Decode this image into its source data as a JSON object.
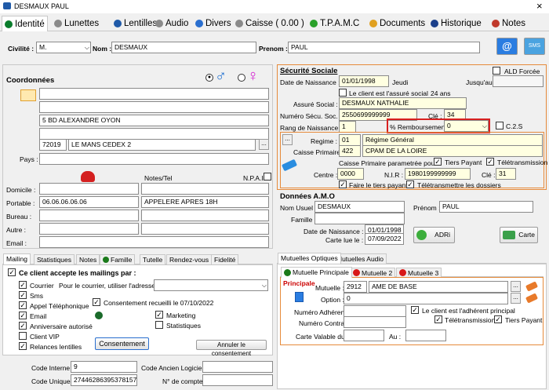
{
  "window": {
    "title": "DESMAUX PAUL",
    "close": "×"
  },
  "tabs": [
    {
      "label": "Identité",
      "icon": "#0a7d2c"
    },
    {
      "label": "Lunettes",
      "icon": "#8a8a8a"
    },
    {
      "label": "Lentilles",
      "icon": "#1f5aa8"
    },
    {
      "label": "Audio",
      "icon": "#8a8a8a"
    },
    {
      "label": "Divers",
      "icon": "#2a6fcf"
    },
    {
      "label": "Caisse ( 0.00 )",
      "icon": "#8a8a8a"
    },
    {
      "label": "T.P.A.M.C",
      "icon": "#2aa02a"
    },
    {
      "label": "Documents",
      "icon": "#e0a020"
    },
    {
      "label": "Historique",
      "icon": "#1a3f8a"
    },
    {
      "label": "Notes",
      "icon": "#c0392b"
    }
  ],
  "header": {
    "civilite_label": "Civilité :",
    "civilite_value": "M.",
    "nom_label": "Nom :",
    "nom_value": "DESMAUX",
    "prenom_label": "Prenom :",
    "prenom_value": "PAUL",
    "at": "@",
    "sms": "SMS"
  },
  "coordonnees": {
    "title": "Coordonnées",
    "addr1": "",
    "addr2": "",
    "addr3": "5 BD ALEXANDRE OYON",
    "addr4": "",
    "cp": "72019",
    "ville": "LE MANS CEDEX 2",
    "dots": "...",
    "pays_label": "Pays :",
    "pays_value": "",
    "notes_label": "Notes/Tel",
    "npai_label": "N.P.A.I",
    "phones": [
      {
        "label": "Domicile :",
        "value": "",
        "note": ""
      },
      {
        "label": "Portable :",
        "value": "06.06.06.06.06",
        "note": "APPELERE APRES 18H"
      },
      {
        "label": "Bureau :",
        "value": "",
        "note": ""
      },
      {
        "label": "Autre :",
        "value": "",
        "note": ""
      },
      {
        "label": "Email :",
        "value": "",
        "note": ""
      }
    ]
  },
  "secu": {
    "title": "Sécurité Sociale",
    "ald_label": "ALD Forcée",
    "dn_label": "Date de Naissance :",
    "dn_value": "01/01/1998",
    "jour": "Jeudi",
    "jusqu_label": "Jusqu'au :",
    "jusqu_value": "",
    "assure_chk_label": "Le client est l'assuré social",
    "age": "24 ans",
    "assure_label": "Assuré Social :",
    "assure_value": "DESMAUX NATHALIE",
    "nss_label": "Numéro Sécu. Soc. :",
    "nss_value": "2550699999999",
    "cle_label": "Clé :",
    "cle_value": "34",
    "rang_label": "Rang de Naissance :",
    "rang_value": "1",
    "remb_label": "% Remboursement :",
    "remb_value": "0",
    "c2s_label": "C.2.S",
    "regime_label": "Regime :",
    "regime_code": "01",
    "regime_value": "Régime Général",
    "caisse_label": "Caisse Primaire :",
    "caisse_code": "422",
    "caisse_value": "CPAM DE LA LOIRE",
    "param_label": "Caisse Primaire parametrée pour :",
    "tiers_label": "Tiers Payant",
    "teletrans_label": "Télétransmission",
    "centre_label": "Centre :",
    "centre_value": "0000",
    "nir_label": "N.I.R :",
    "nir_value": "1980199999999",
    "cle2_label": "Clé :",
    "cle2_value": "31",
    "faire_label": "Faire le tiers payant",
    "teledos_label": "Télétransmettre les dossiers",
    "dots": "..."
  },
  "amo": {
    "title": "Données A.M.O",
    "nom_label": "Nom Usuel :",
    "nom_value": "DESMAUX",
    "prenom_label": "Prénom :",
    "prenom_value": "PAUL",
    "famille_label": "Famille :",
    "famille_value": "",
    "dn_label": "Date de Naissance :",
    "dn_value": "01/01/1998",
    "carte_label": "Carte lue le :",
    "carte_value": "07/09/2022",
    "adri": "ADRi",
    "carte_btn": "Carte"
  },
  "mailing": {
    "tabs": [
      "Mailing",
      "Statistiques",
      "Notes",
      "Famille",
      "Tutelle",
      "Rendez-vous",
      "Fidelité"
    ],
    "accept_label": "Ce client accepte les mailings par :",
    "courrier_label": "Courrier",
    "courrier_hint": "Pour le courrier, utiliser l'adresse de :",
    "sms_label": "Sms",
    "appel_label": "Appel Téléphonique",
    "consent_label": "Consentement recueilli le 07/10/2022",
    "email_label": "Email",
    "marketing_label": "Marketing",
    "anniv_label": "Anniversaire autorisé",
    "stats_label": "Statistiques",
    "vip_label": "Client VIP",
    "relances_label": "Relances lentilles",
    "consent_btn": "Consentement",
    "annuler_btn": "Annuler le consentement"
  },
  "codes": {
    "interne_label": "Code Interne :",
    "interne_value": "9",
    "ancien_label": "Code Ancien Logiciel :",
    "ancien_value": "",
    "unique_label": "Code Unique :",
    "unique_value": "27446286395378157",
    "compte_label": "N° de compte :",
    "compte_value": ""
  },
  "mutuelles": {
    "tabs": [
      "Mutuelles Optiques",
      "Mutuelles Audio"
    ],
    "subtabs": [
      "Mutuelle Principale",
      "Mutuelle 2",
      "Mutuelle 3"
    ],
    "principale": "Principale",
    "mutuelle_label": "Mutuelle :",
    "mutuelle_code": "2912",
    "mutuelle_value": "AME DE BASE",
    "option_label": "Option :",
    "option_code": "0",
    "option_value": "",
    "adherent_label": "Numéro Adhérent :",
    "adherent_value": "",
    "contrat_label": "Numéro Contrat :",
    "contrat_value": "",
    "adh_chk_label": "Le client est l'adhérent principal",
    "teletrans_label": "Télétransmission",
    "tiers_label": "Tiers Payant",
    "valable_label": "Carte Valable du :",
    "valable_value": "",
    "au_label": "Au :",
    "au_value": "",
    "dots": "..."
  }
}
